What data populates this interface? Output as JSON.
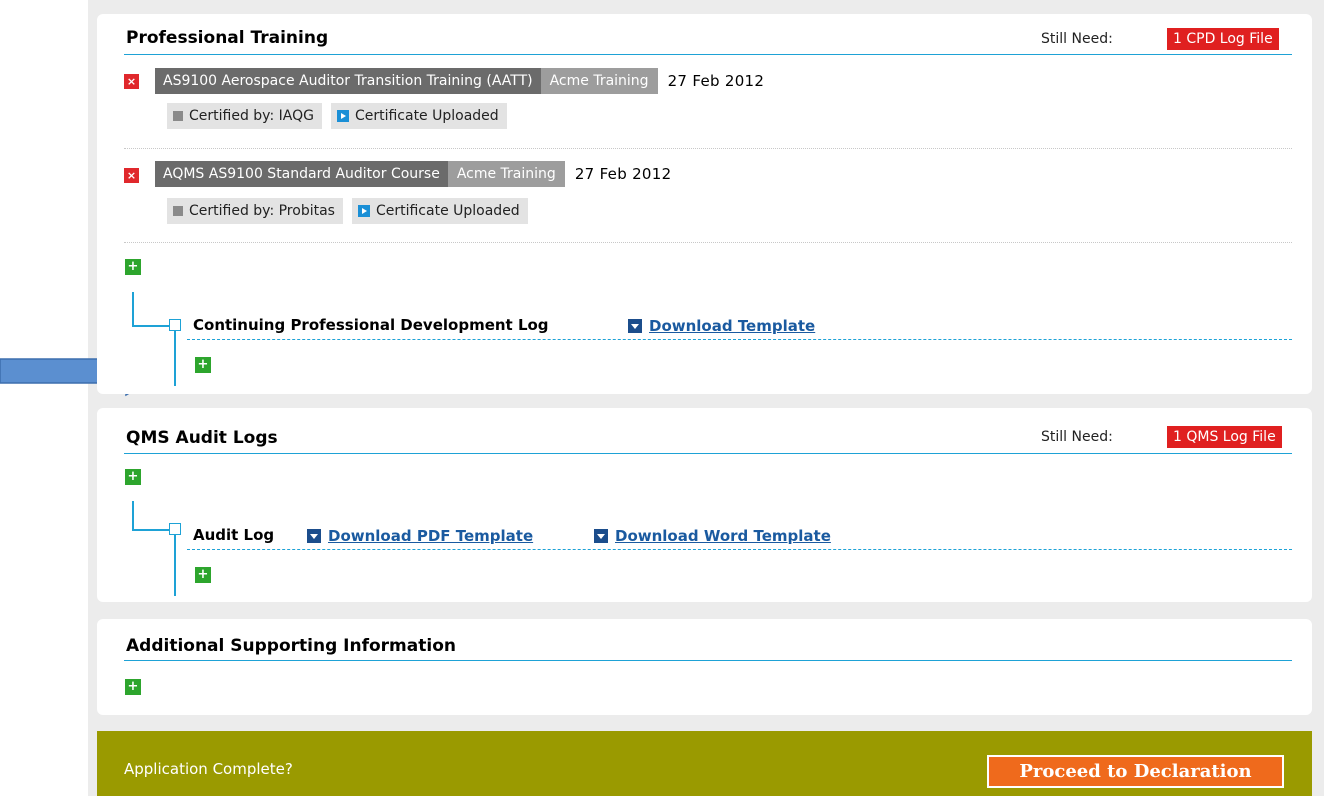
{
  "professional_training": {
    "title": "Professional Training",
    "still_need_label": "Still Need:",
    "need_badge": "1 CPD Log File",
    "remove_symbol": "×",
    "entries": [
      {
        "course": "AS9100 Aerospace Auditor Transition Training (AATT)",
        "provider": "Acme Training",
        "date": "27 Feb 2012",
        "certified_by": "Certified by: IAQG",
        "certificate_status": "Certificate Uploaded"
      },
      {
        "course": "AQMS AS9100 Standard Auditor Course",
        "provider": "Acme Training",
        "date": "27 Feb 2012",
        "certified_by": "Certified by: Probitas",
        "certificate_status": "Certificate Uploaded"
      }
    ],
    "add_symbol": "+",
    "cpd_log": {
      "title": "Continuing Professional Development Log",
      "download_label": "Download Template"
    }
  },
  "qms_audit_logs": {
    "title": "QMS Audit Logs",
    "still_need_label": "Still Need:",
    "need_badge": "1 QMS Log File",
    "audit_log": {
      "title": "Audit Log",
      "download_pdf_label": "Download PDF Template",
      "download_word_label": "Download Word Template"
    }
  },
  "additional_info": {
    "title": "Additional Supporting Information"
  },
  "footer": {
    "label": "Application Complete?",
    "proceed_label": "Proceed to Declaration"
  },
  "colors": {
    "accent_blue": "#1ea2d6",
    "need_red": "#e02020",
    "add_green": "#2da52d",
    "footer_olive": "#9a9a00",
    "proceed_orange": "#ef6a1c",
    "arrow_blue": "#5b8fd0"
  }
}
